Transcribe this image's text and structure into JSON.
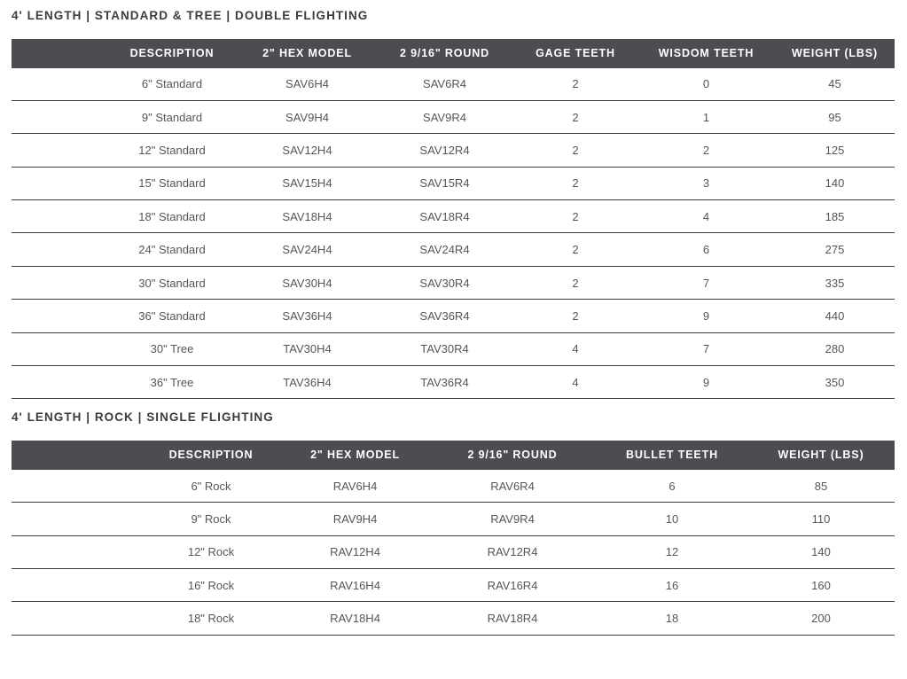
{
  "sections": [
    {
      "title": "4' LENGTH | STANDARD & TREE | DOUBLE FLIGHTING",
      "table": {
        "columns": [
          "DESCRIPTION",
          "2\" HEX MODEL",
          "2 9/16\" ROUND",
          "GAGE TEETH",
          "WISDOM TEETH",
          "WEIGHT (LBS)"
        ],
        "rows": [
          [
            "6\" Standard",
            "SAV6H4",
            "SAV6R4",
            "2",
            "0",
            "45"
          ],
          [
            "9\" Standard",
            "SAV9H4",
            "SAV9R4",
            "2",
            "1",
            "95"
          ],
          [
            "12\" Standard",
            "SAV12H4",
            "SAV12R4",
            "2",
            "2",
            "125"
          ],
          [
            "15\" Standard",
            "SAV15H4",
            "SAV15R4",
            "2",
            "3",
            "140"
          ],
          [
            "18\" Standard",
            "SAV18H4",
            "SAV18R4",
            "2",
            "4",
            "185"
          ],
          [
            "24\" Standard",
            "SAV24H4",
            "SAV24R4",
            "2",
            "6",
            "275"
          ],
          [
            "30\" Standard",
            "SAV30H4",
            "SAV30R4",
            "2",
            "7",
            "335"
          ],
          [
            "36\" Standard",
            "SAV36H4",
            "SAV36R4",
            "2",
            "9",
            "440"
          ],
          [
            "30\" Tree",
            "TAV30H4",
            "TAV30R4",
            "4",
            "7",
            "280"
          ],
          [
            "36\" Tree",
            "TAV36H4",
            "TAV36R4",
            "4",
            "9",
            "350"
          ]
        ]
      }
    },
    {
      "title": "4' LENGTH | ROCK | SINGLE FLIGHTING",
      "table": {
        "columns": [
          "DESCRIPTION",
          "2\" HEX MODEL",
          "2 9/16\" ROUND",
          "BULLET TEETH",
          "WEIGHT (LBS)"
        ],
        "rows": [
          [
            "6\" Rock",
            "RAV6H4",
            "RAV6R4",
            "6",
            "85"
          ],
          [
            "9\" Rock",
            "RAV9H4",
            "RAV9R4",
            "10",
            "110"
          ],
          [
            "12\" Rock",
            "RAV12H4",
            "RAV12R4",
            "12",
            "140"
          ],
          [
            "16\" Rock",
            "RAV16H4",
            "RAV16R4",
            "16",
            "160"
          ],
          [
            "18\" Rock",
            "RAV18H4",
            "RAV18R4",
            "18",
            "200"
          ]
        ]
      }
    }
  ],
  "colors": {
    "header_background": "#4C4D52",
    "header_text": "#FFFFFF",
    "body_text": "#55565A",
    "title_text": "#3B3C40",
    "row_divider": "#3D3D3F",
    "page_background": "#FFFFFF"
  }
}
